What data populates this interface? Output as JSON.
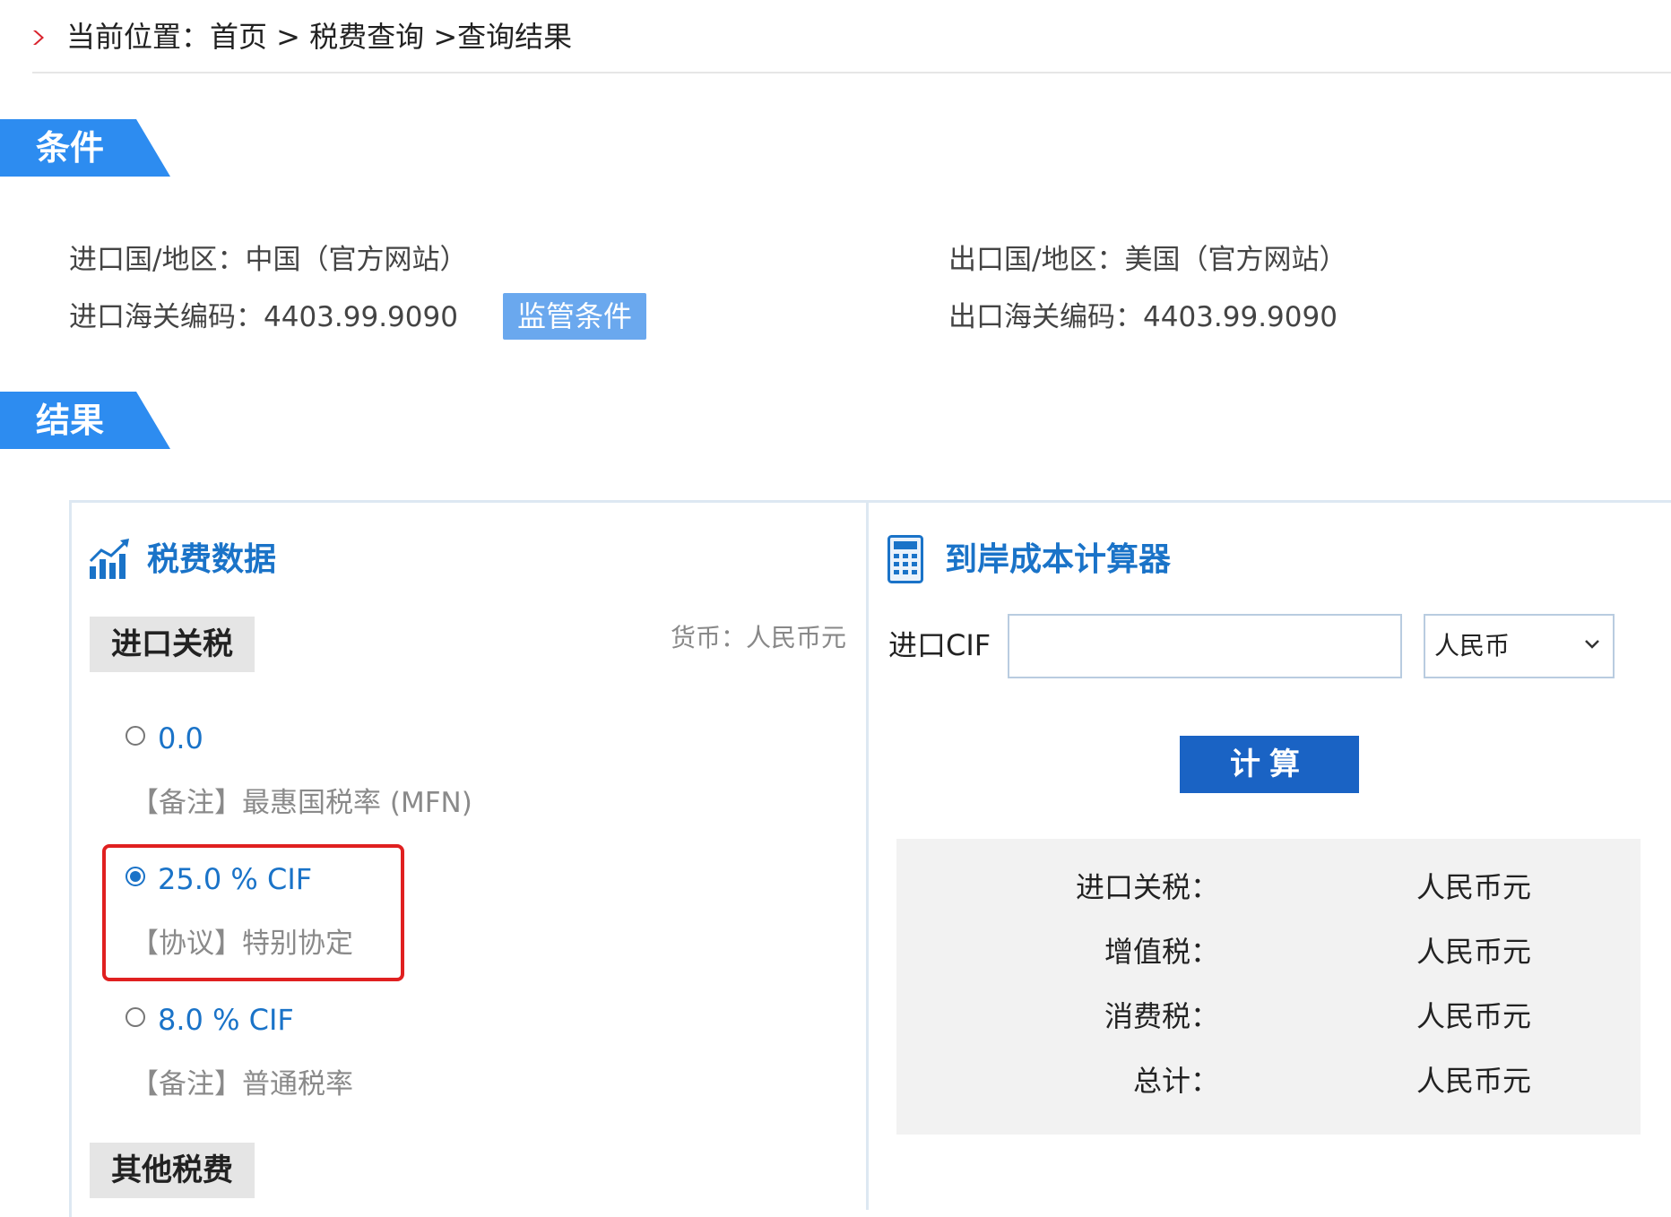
{
  "breadcrumb": {
    "text": "当前位置：首页 > 税费查询 >查询结果"
  },
  "sections": {
    "conditions_title": "条件",
    "results_title": "结果"
  },
  "conditions": {
    "import_country_label": "进口国/地区：",
    "import_country_value": "中国（官方网站）",
    "export_country_label": "出口国/地区：",
    "export_country_value": "美国（官方网站）",
    "import_code_label": "进口海关编码：",
    "import_code_value": "4403.99.9090",
    "export_code_label": "出口海关编码：",
    "export_code_value": "4403.99.9090",
    "supervision_button": "监管条件"
  },
  "tax_data": {
    "title": "税费数据",
    "import_duty_tag": "进口关税",
    "currency_note": "货币：人民币元",
    "options": [
      {
        "rate": "0.0",
        "note": "【备注】最惠国税率 (MFN)",
        "checked": false
      },
      {
        "rate": "25.0 % CIF",
        "note": "【协议】特别协定",
        "checked": true
      },
      {
        "rate": "8.0 % CIF",
        "note": "【备注】普通税率",
        "checked": false
      }
    ],
    "other_fees_tag": "其他税费"
  },
  "calculator": {
    "title": "到岸成本计算器",
    "cif_label": "进口CIF",
    "cif_value": "",
    "currency_selected": "人民币",
    "calc_button": "计算",
    "results": [
      {
        "label": "进口关税：",
        "value": "人民币元"
      },
      {
        "label": "增值税：",
        "value": "人民币元"
      },
      {
        "label": "消费税：",
        "value": "人民币元"
      },
      {
        "label": "总计：",
        "value": "人民币元"
      }
    ]
  },
  "colors": {
    "accent_blue": "#1a73c8",
    "tab_blue": "#2d8cf0",
    "button_light_blue": "#6aa8ee",
    "highlight_red": "#e02020"
  }
}
